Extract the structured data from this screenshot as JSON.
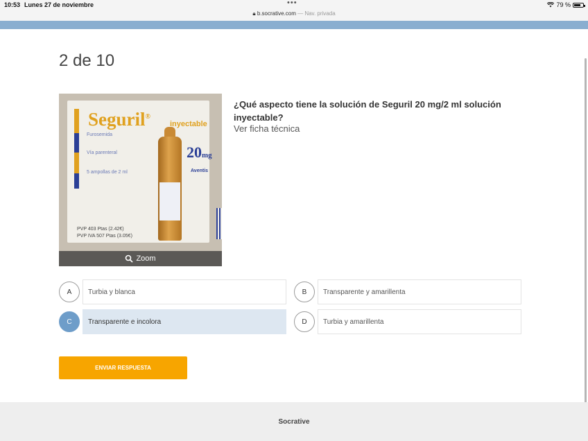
{
  "status_bar": {
    "time": "10:53",
    "date": "Lunes 27 de noviembre",
    "url": "b.socrative.com",
    "private_label": "— Nav. privada",
    "battery": "79 %",
    "battery_level": 0.79,
    "icons": [
      "lock-icon",
      "wifi-icon",
      "battery-icon"
    ]
  },
  "quiz": {
    "progress": "2 de 10",
    "question": "¿Qué aspecto tiene la solución de Seguril 20 mg/2 ml solución inyectable?",
    "ficha_link": "Ver ficha técnica",
    "zoom_label": "Zoom",
    "image": {
      "brand": "Seguril",
      "sub": "inyectable",
      "dose": "20",
      "dose_unit": "mg",
      "generic": "Furosemida",
      "route": "Vía parenteral",
      "pack": "5 ampollas de 2 ml",
      "maker": "Aventis",
      "pvp": "PVP 403 Ptas (2.42€)",
      "pvpiva": "PVP IVA 507 Ptas (3.05€)"
    },
    "answers": [
      {
        "letter": "A",
        "text": "Turbia y blanca",
        "selected": false
      },
      {
        "letter": "B",
        "text": "Transparente y amarillenta",
        "selected": false
      },
      {
        "letter": "C",
        "text": "Transparente e incolora",
        "selected": true
      },
      {
        "letter": "D",
        "text": "Turbia y amarillenta",
        "selected": false
      }
    ],
    "submit_label": "ENVIAR RESPUESTA"
  },
  "footer": {
    "brand": "Socrative"
  },
  "colors": {
    "accent": "#f7a500",
    "selected": "#6e9dc9",
    "selected_bg": "#dde7f1",
    "top_bar": "#8aaed0"
  }
}
